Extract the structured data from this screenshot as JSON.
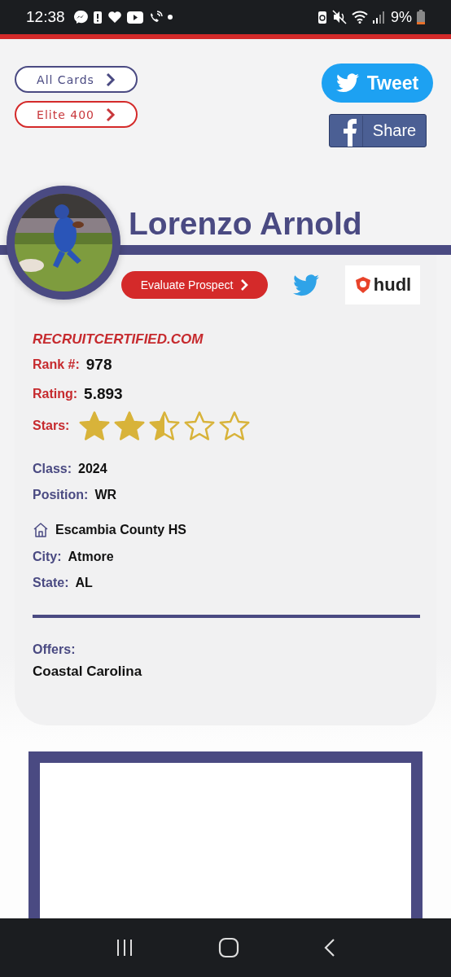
{
  "status_bar": {
    "time": "12:38",
    "battery": "9%"
  },
  "nav_buttons": [
    {
      "label": "All Cards",
      "kind": "primary"
    },
    {
      "label": "Elite 400",
      "kind": "accent"
    }
  ],
  "share": {
    "tweet": "Tweet",
    "share": "Share"
  },
  "player": {
    "name": "Lorenzo Arnold",
    "evaluate": "Evaluate Prospect",
    "hudl": "hudl",
    "site": "RECRUITCERTIFIED.COM",
    "rank_label": "Rank #:",
    "rank": "978",
    "rating_label": "Rating:",
    "rating": "5.893",
    "stars_label": "Stars:",
    "stars": 2.5,
    "fields": [
      {
        "label": "Class:",
        "value": "2024"
      },
      {
        "label": "Position:",
        "value": "WR"
      }
    ],
    "school": "Escambia County HS",
    "location": [
      {
        "label": "City:",
        "value": "Atmore"
      },
      {
        "label": "State:",
        "value": "AL"
      }
    ],
    "offers_label": "Offers:",
    "offers": [
      "Coastal Carolina"
    ]
  }
}
